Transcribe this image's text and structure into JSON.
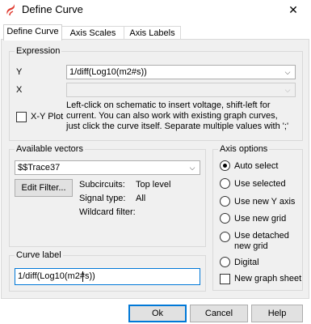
{
  "window": {
    "title": "Define Curve",
    "close_glyph": "✕",
    "icon": "app-logo-icon"
  },
  "tabs": [
    {
      "label": "Define Curve",
      "active": true
    },
    {
      "label": "Axis Scales",
      "active": false
    },
    {
      "label": "Axis Labels",
      "active": false
    }
  ],
  "expression": {
    "legend": "Expression",
    "y_label": "Y",
    "y_value": "1/diff(Log10(m2#s))",
    "x_label": "X",
    "x_value": "",
    "xy_plot_label": "X-Y Plot",
    "xy_plot_checked": false,
    "help_lines": [
      "Left-click on schematic to insert voltage, shift-left for",
      "current. You can also work with existing graph curves,",
      "just click the curve itself. Separate multiple values with ';'"
    ]
  },
  "vectors": {
    "legend": "Available vectors",
    "selected": "$$Trace37",
    "edit_filter_label": "Edit Filter...",
    "subcircuits_label": "Subcircuits:",
    "subcircuits_value": "Top level",
    "signal_type_label": "Signal type:",
    "signal_type_value": "All",
    "wildcard_label": "Wildcard filter:"
  },
  "axis_options": {
    "legend": "Axis options",
    "options": [
      {
        "label": "Auto select",
        "checked": true
      },
      {
        "label": "Use selected",
        "checked": false
      },
      {
        "label": "Use new Y axis",
        "checked": false
      },
      {
        "label": "Use new grid",
        "checked": false
      },
      {
        "label_line1": "Use detached",
        "label_line2": "new grid",
        "checked": false
      },
      {
        "label": "Digital",
        "checked": false
      }
    ],
    "new_graph_sheet_label": "New graph sheet",
    "new_graph_sheet_checked": false
  },
  "curve_label": {
    "legend": "Curve label",
    "value": "1/diff(Log10(m2#s))"
  },
  "buttons": {
    "ok": "Ok",
    "cancel": "Cancel",
    "help": "Help"
  },
  "colors": {
    "focus_border": "#0078d7",
    "panel_bg": "#f0f0f0",
    "brand_red": "#e03a2f"
  }
}
